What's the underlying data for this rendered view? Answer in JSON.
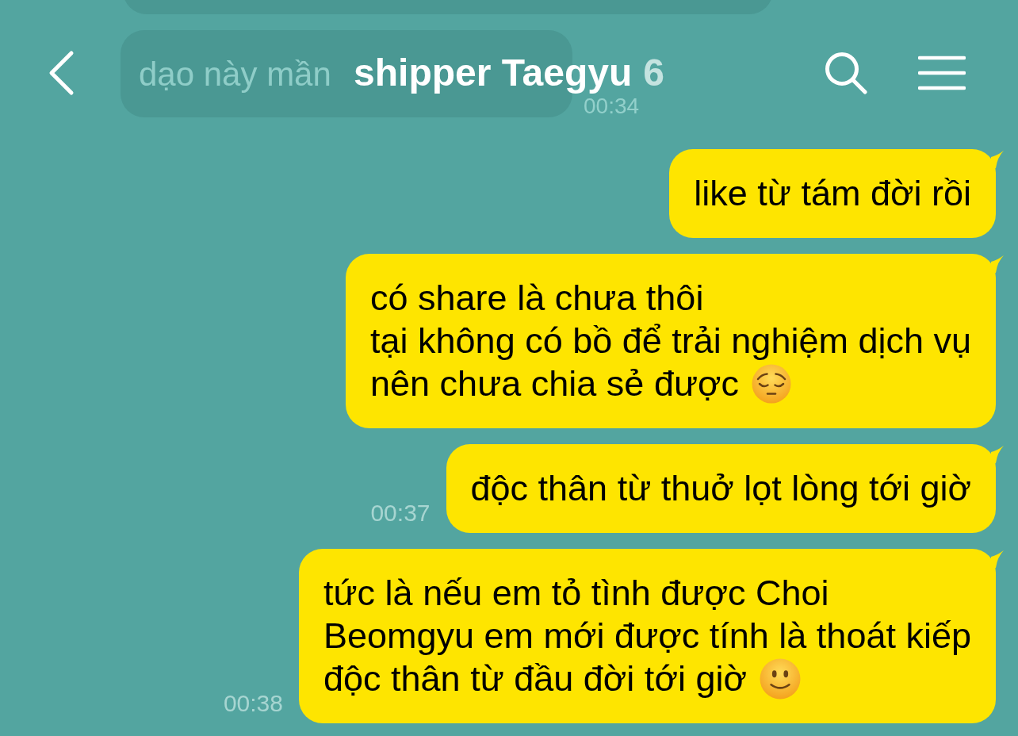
{
  "header": {
    "title": "shipper Taegyu",
    "member_count": "6"
  },
  "background_messages": [
    {
      "text": "dạo này mần",
      "time": "00:34"
    }
  ],
  "messages": [
    {
      "kind": "plain",
      "lines": [
        "like từ tám đời rồi"
      ]
    },
    {
      "kind": "pensive",
      "lines": [
        "có share là chưa thôi",
        "tại không có bồ để trải nghiệm dịch vụ",
        "nên chưa chia sẻ được"
      ]
    },
    {
      "kind": "plain",
      "lines": [
        "độc thân từ thuở lọt lòng tới giờ"
      ],
      "time": "00:37"
    },
    {
      "kind": "smiling",
      "lines": [
        "tức là nếu em tỏ tình được Choi",
        "Beomgyu em mới được tính là thoát kiếp",
        "độc thân từ đầu đời tới giờ"
      ],
      "time": "00:38"
    }
  ]
}
